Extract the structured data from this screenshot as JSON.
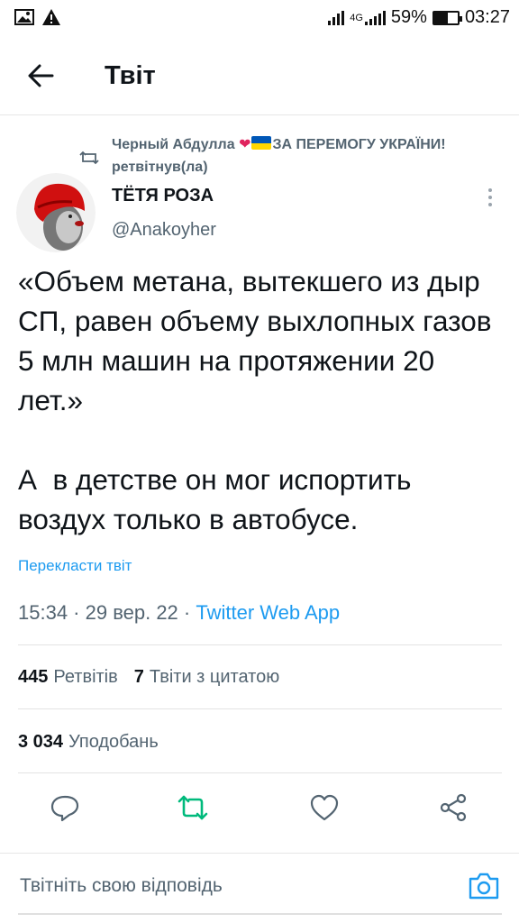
{
  "status_bar": {
    "network": "4G",
    "battery_percent": "59%",
    "battery_level": 0.59,
    "time": "03:27",
    "icons": [
      "image-icon",
      "warning-icon",
      "signal-icon",
      "battery-icon"
    ]
  },
  "header": {
    "title": "Твіт"
  },
  "retweet": {
    "name_before_heart": "Черный Абдулла ",
    "heart": "❤",
    "line_rest": "ЗА ПЕРЕМОГУ УКРАЇНИ! ретвітнув(ла)"
  },
  "author": {
    "name": "ТЁТЯ РОЗА",
    "handle": "@Anakoyher"
  },
  "tweet": {
    "text": "«Объем метана, вытекшего из дыр СП, равен объему выхлопных газов 5 млн машин на протяжении 20 лет.»\n\nА  в детстве он мог испортить воздух только в автобусе.",
    "translate": "Перекласти твіт",
    "time": "15:34 · 29 вер. 22 · ",
    "source": "Twitter Web App"
  },
  "stats": {
    "retweets_count": "445",
    "retweets_label": "Ретвітів",
    "quotes_count": "7",
    "quotes_label": "Твіти з цитатою",
    "likes_count": "3 034",
    "likes_label": "Уподобань"
  },
  "reply": {
    "placeholder": "Твітніть свою відповідь"
  },
  "colors": {
    "accent": "#1d9bf0",
    "retweet_green": "#00ba7c",
    "secondary_text": "#536471",
    "heart": "#e0245e"
  }
}
